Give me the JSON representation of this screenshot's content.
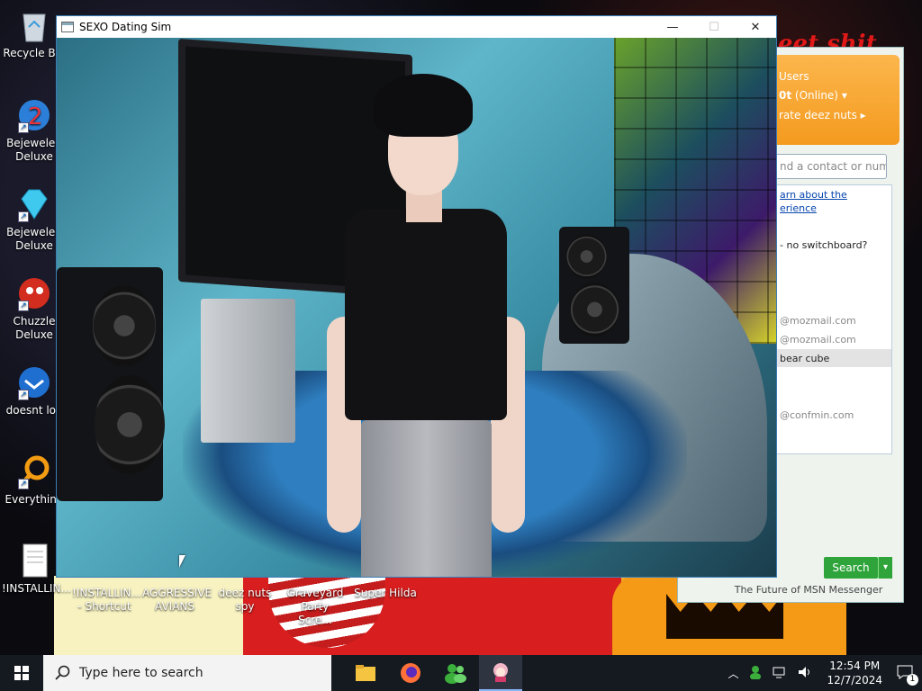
{
  "desktop": {
    "icons": [
      {
        "label": "Recycle Bin",
        "icon": "recycle-bin-icon"
      },
      {
        "label": "Bejeweled Deluxe",
        "icon": "bejeweled-2-icon"
      },
      {
        "label": "Bejeweled Deluxe",
        "icon": "bejeweled-gem-icon"
      },
      {
        "label": "Chuzzle Deluxe",
        "icon": "chuzzle-icon"
      },
      {
        "label": "doesnt loa",
        "icon": "thunderbird-icon"
      },
      {
        "label": "Everything",
        "icon": "everything-search-icon"
      },
      {
        "label": "!INSTALLIN...",
        "icon": "document-icon"
      }
    ],
    "bottom_icons": [
      {
        "label": "!INSTALLIN... - Shortcut"
      },
      {
        "label": "AGGRESSIVE AVIANS"
      },
      {
        "label": "deez nuts spy"
      },
      {
        "label": "Graveyard Party Scre..."
      },
      {
        "label": "Super Hilda"
      }
    ]
  },
  "game_window": {
    "title": "SEXO Dating Sim",
    "minimize": "—",
    "maximize": "☐",
    "close": "✕"
  },
  "msn": {
    "status_name": "0t",
    "status": "(Online)",
    "personal_message": "rate deez nuts",
    "search_placeholder": "nd a contact or numbe",
    "link_line1": "arn about the",
    "link_line2": "erience",
    "contacts": [
      "- no switchboard?",
      "@mozmail.com",
      "@mozmail.com",
      "bear cube",
      "@confmin.com"
    ],
    "search_button": "Search",
    "footer": "The Future of MSN Messenger",
    "title_fragment": "Users"
  },
  "wallpaper_text": "eet shit",
  "taskbar": {
    "search_placeholder": "Type here to search",
    "time": "12:54 PM",
    "date": "12/7/2024",
    "notification_count": "1"
  },
  "colors": {
    "accent": "#3a7db5",
    "msn_orange": "#f49a1f",
    "msn_green": "#2ea43a"
  }
}
